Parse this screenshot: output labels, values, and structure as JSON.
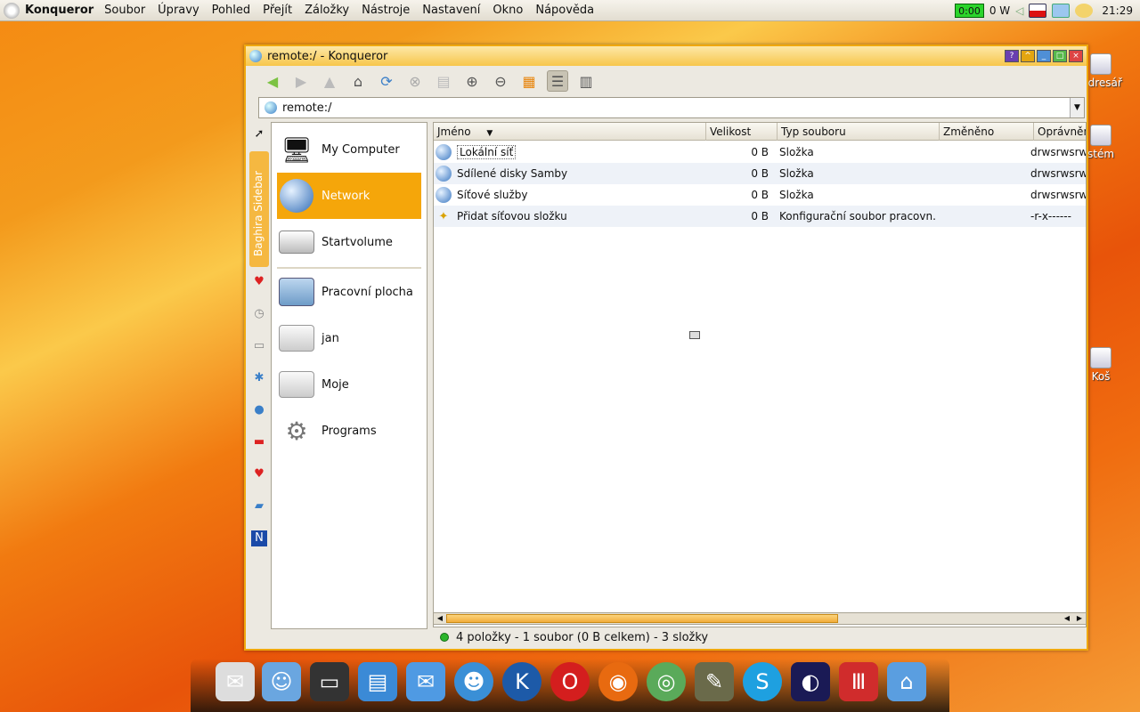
{
  "menubar": {
    "app": "Konqueror",
    "items": [
      "Soubor",
      "Úpravy",
      "Pohled",
      "Přejít",
      "Záložky",
      "Nástroje",
      "Nastavení",
      "Okno",
      "Nápověda"
    ],
    "battery": "0:00",
    "power": "0 W",
    "clock": "21:29"
  },
  "desktop": {
    "icons": [
      "Adresář",
      "Systém",
      "Koš"
    ],
    "icon_labels_visible": [
      "ndresář",
      "stém",
      "Koš"
    ]
  },
  "window": {
    "title": "remote:/ - Konqueror",
    "location": "remote:/",
    "sidebar_tab": "Baghira Sidebar",
    "sidebar_items": [
      {
        "label": "My Computer",
        "icon": "computer-icon"
      },
      {
        "label": "Network",
        "icon": "network-globe-icon",
        "selected": true
      },
      {
        "label": "Startvolume",
        "icon": "harddisk-icon"
      },
      {
        "label": "Pracovní plocha",
        "icon": "desktop-folder-icon"
      },
      {
        "label": "jan",
        "icon": "home-folder-icon"
      },
      {
        "label": "Moje",
        "icon": "folder-icon"
      },
      {
        "label": "Programs",
        "icon": "kde-programs-icon"
      }
    ],
    "columns": [
      "Jméno",
      "Velikost",
      "Typ souboru",
      "Změněno",
      "Oprávnění"
    ],
    "columns_visible": [
      "Jméno",
      "Velikost",
      "Typ souboru",
      "Změněno",
      "Oprávněn"
    ],
    "rows": [
      {
        "name": "Lokální síť",
        "size": "0 B",
        "type": "Složka",
        "changed": "",
        "perm": "drwsrwsrw"
      },
      {
        "name": "Sdílené disky Samby",
        "size": "0 B",
        "type": "Složka",
        "changed": "",
        "perm": "drwsrwsrw"
      },
      {
        "name": "Síťové služby",
        "size": "0 B",
        "type": "Složka",
        "changed": "",
        "perm": "drwsrwsrw"
      },
      {
        "name": "Přidat síťovou složku",
        "size": "0 B",
        "type": "Konfigurační soubor pracovn...",
        "changed": "",
        "perm": "-r-x------"
      }
    ],
    "status": "4 položky - 1 soubor (0 B celkem) - 3 složky"
  },
  "dock": {
    "apps": [
      "kontact",
      "kdict",
      "terminal",
      "archive",
      "mail",
      "kopete",
      "konqueror",
      "opera",
      "firefox",
      "network",
      "gimp",
      "skype",
      "screensaver",
      "office",
      "home"
    ]
  }
}
